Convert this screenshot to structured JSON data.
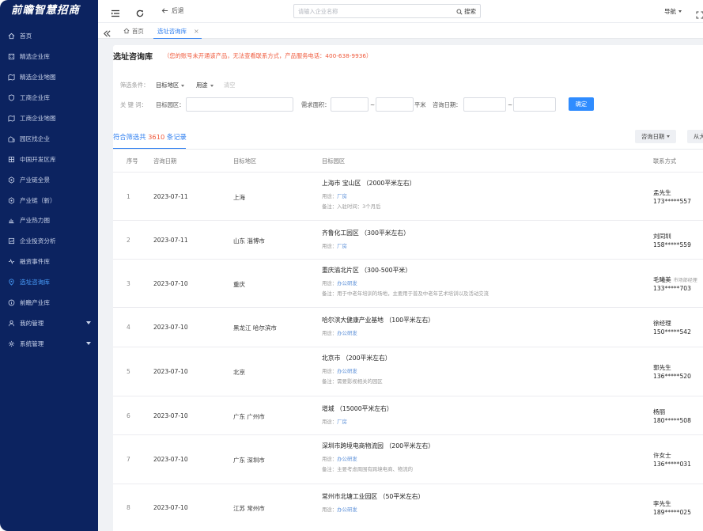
{
  "app": {
    "logo": "前瞻智慧招商"
  },
  "sidebar": {
    "items": [
      {
        "label": "首页",
        "icon": "home-icon"
      },
      {
        "label": "精选企业库",
        "icon": "building-icon"
      },
      {
        "label": "精选企业地图",
        "icon": "map-icon"
      },
      {
        "label": "工商企业库",
        "icon": "shield-icon"
      },
      {
        "label": "工商企业地图",
        "icon": "map-icon"
      },
      {
        "label": "园区找企业",
        "icon": "park-icon"
      },
      {
        "label": "中国开发区库",
        "icon": "grid-icon"
      },
      {
        "label": "产业链全景",
        "icon": "hexagon-icon"
      },
      {
        "label": "产业链（新）",
        "icon": "hexagon-icon"
      },
      {
        "label": "产业热力图",
        "icon": "chart-icon"
      },
      {
        "label": "企业投资分析",
        "icon": "analysis-icon"
      },
      {
        "label": "融资事件库",
        "icon": "pulse-icon"
      },
      {
        "label": "选址咨询库",
        "icon": "location-icon"
      },
      {
        "label": "前瞻产业库",
        "icon": "info-icon"
      },
      {
        "label": "我的管理",
        "icon": "user-icon"
      },
      {
        "label": "系统管理",
        "icon": "gear-icon"
      }
    ]
  },
  "topbar": {
    "back_label": "后退",
    "search_placeholder": "请输入企业名称",
    "search_label": "搜索",
    "nav_label": "导航"
  },
  "tabs": [
    {
      "label": "首页"
    },
    {
      "label": "选址咨询库"
    }
  ],
  "page": {
    "title": "选址咨询库",
    "notice": "（您的账号未开通该产品，无法查看联系方式，产品服务电话：400-638-9936）",
    "filter_label": "筛选条件：",
    "filter_region": "目标地区",
    "filter_use": "用途",
    "clear_label": "清空",
    "keyword_label": "关 键 词：",
    "target_park_label": "目标园区：",
    "area_label": "需求面积：",
    "area_unit": "平米",
    "date_label": "咨询日期：",
    "dash": "~",
    "confirm_label": "确定",
    "result_prefix": "符合筛选共",
    "result_count": "3610",
    "result_suffix": "条记录",
    "sort_date": "咨询日期",
    "sort_other": "从大"
  },
  "table": {
    "headers": [
      "序号",
      "咨询日期",
      "目标地区",
      "目标园区",
      "联系方式"
    ],
    "use_prefix": "用途：",
    "note_prefix": "备注：",
    "rows": [
      {
        "idx": "1",
        "date": "2023-07-11",
        "region": "上海",
        "park": "上海市 宝山区 （2000平米左右）",
        "use": "厂房",
        "note": "入驻时间：3个月后",
        "contact": "孟先生",
        "company": "",
        "phone": "173*****557"
      },
      {
        "idx": "2",
        "date": "2023-07-11",
        "region": "山东 淄博市",
        "park": "齐鲁化工园区 （300平米左右）",
        "use": "厂房",
        "note": "",
        "contact": "刘同圳",
        "company": "",
        "phone": "158*****559"
      },
      {
        "idx": "3",
        "date": "2023-07-10",
        "region": "重庆",
        "park": "重庆渝北片区 （300-500平米）",
        "use": "办公研发",
        "note": "用于中老年培训的场地，主要用于普及中老年艺术培训以及活动交流",
        "contact": "毛曦美",
        "company": "市场部经理",
        "phone": "133*****703"
      },
      {
        "idx": "4",
        "date": "2023-07-10",
        "region": "黑龙江 哈尔滨市",
        "park": "哈尔滨大健康产业基地 （100平米左右）",
        "use": "办公研发",
        "note": "",
        "contact": "徐经理",
        "company": "",
        "phone": "150*****542"
      },
      {
        "idx": "5",
        "date": "2023-07-10",
        "region": "北京",
        "park": "北京市 （200平米左右）",
        "use": "办公研发",
        "note": "需要影视相关的园区",
        "contact": "郭先生",
        "company": "",
        "phone": "136*****520"
      },
      {
        "idx": "6",
        "date": "2023-07-10",
        "region": "广东 广州市",
        "park": "增城 （15000平米左右）",
        "use": "厂房",
        "note": "",
        "contact": "杨丽",
        "company": "",
        "phone": "180*****508"
      },
      {
        "idx": "7",
        "date": "2023-07-10",
        "region": "广东 深圳市",
        "park": "深圳市跨境电商物流园 （200平米左右）",
        "use": "办公研发",
        "note": "主要考虑周围有跨境电商、物流的",
        "contact": "许女士",
        "company": "",
        "phone": "136*****031"
      },
      {
        "idx": "8",
        "date": "2023-07-10",
        "region": "江苏 常州市",
        "park": "常州市北塘工业园区 （50平米左右）",
        "use": "办公研发",
        "note": "",
        "contact": "李先生",
        "company": "",
        "phone": "189*****025"
      }
    ]
  }
}
